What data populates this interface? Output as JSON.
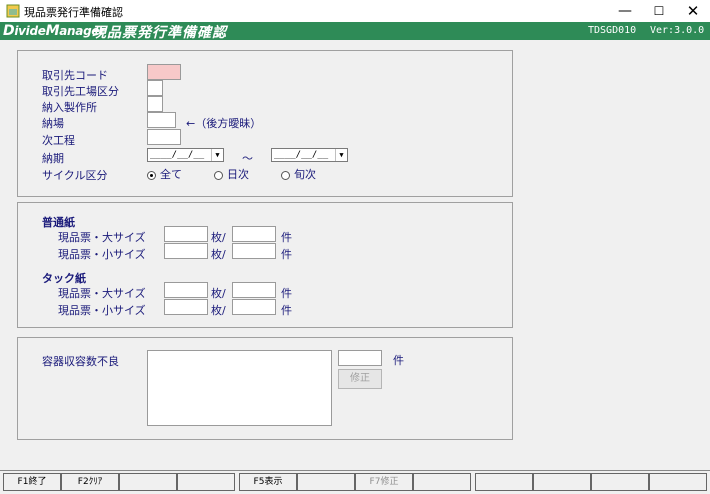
{
  "window": {
    "title": "現品票発行準備確認",
    "minimize": "—",
    "maximize": "☐",
    "close": "✕"
  },
  "header": {
    "logo_d": "D",
    "logo_ivide": "ivide",
    "logo_m": "M",
    "logo_anager": "anager",
    "screen_title": "現品票発行準備確認",
    "screen_id": "TDSGD010",
    "version": "Ver:3.0.0"
  },
  "form": {
    "supplier_code_label": "取引先コード",
    "supplier_factory_label": "取引先工場区分",
    "delivery_plant_label": "納入製作所",
    "delivery_place_label": "納場",
    "delivery_place_note": "←（後方曖昧）",
    "next_process_label": "次工程",
    "due_date_label": "納期",
    "date_from_value": "____/__/__",
    "date_to_value": "____/__/__",
    "date_separator": "～",
    "cycle_label": "サイクル区分",
    "cycle_options": [
      "全て",
      "日次",
      "旬次"
    ],
    "cycle_selected": "全て"
  },
  "paper": {
    "plain_paper_label": "普通紙",
    "tack_paper_label": "タック紙",
    "large_label": "現品票・大サイズ",
    "small_label": "現品票・小サイズ",
    "sheets_unit": "枚/",
    "items_unit": "件"
  },
  "container": {
    "label": "容器収容数不良",
    "items_unit": "件",
    "fix_button": "修正"
  },
  "function_keys": [
    "F1終了",
    "F2ｸﾘｱ",
    "",
    "",
    "F5表示",
    "",
    "F7修正",
    "",
    "",
    "",
    "",
    ""
  ]
}
